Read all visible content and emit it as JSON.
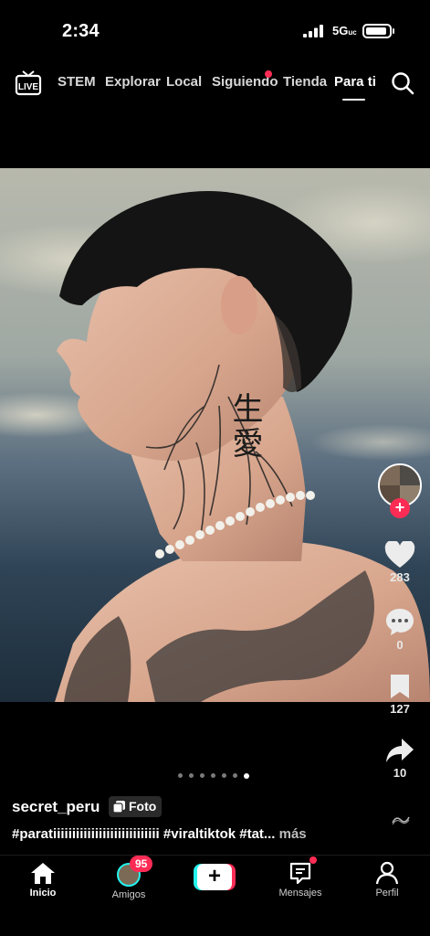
{
  "status_bar": {
    "time": "2:34",
    "network": "5G"
  },
  "top_nav": {
    "live_label": "LIVE",
    "tabs": [
      "STEM",
      "Explorar",
      "Local",
      "Siguiendo",
      "Tienda",
      "Para ti"
    ],
    "active_tab": "Para ti"
  },
  "post": {
    "tattoo_text": "生愛",
    "likes": "283",
    "comments": "0",
    "saves": "127",
    "shares": "10",
    "carousel": {
      "total": 7,
      "current": 7
    },
    "username": "secret_peru",
    "type_badge": "Foto",
    "caption": "#paratiiiiiiiiiiiiiiiiiiiiiiiiiiii #viraltiktok #tat...",
    "more_label": "más"
  },
  "bottom_nav": {
    "items": [
      "Inicio",
      "Amigos",
      "",
      "Mensajes",
      "Perfil"
    ],
    "friends_badge": "95"
  },
  "colors": {
    "accent": "#fe2c55",
    "cyan": "#25f4ee",
    "background": "#000000"
  }
}
